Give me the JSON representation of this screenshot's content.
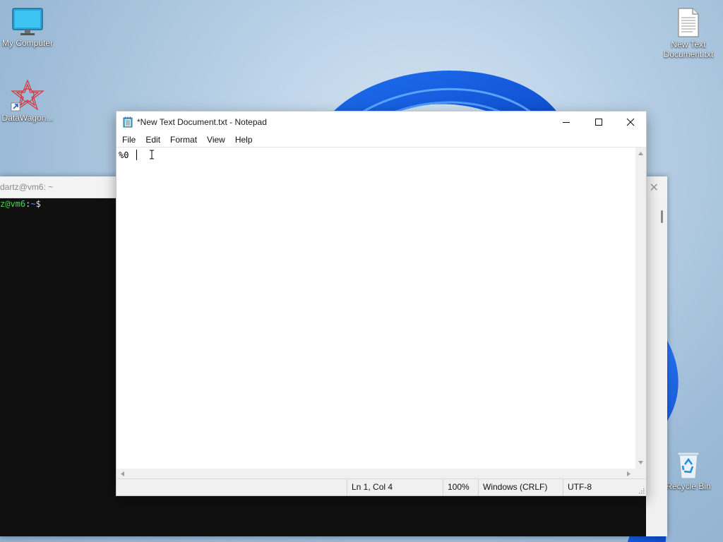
{
  "desktop": {
    "icons": {
      "my_computer": "My Computer",
      "datawagon": "DataWagon...",
      "new_text_doc": "New Text Document.txt",
      "recycle_bin": "Recycle Bin"
    }
  },
  "terminal": {
    "title": "dartz@vm6: ~",
    "prompt_user": "z@vm6",
    "prompt_sep": ":",
    "prompt_path": "~",
    "prompt_symbol": "$",
    "colors": {
      "user": "#4fd14f",
      "path": "#5b8cff",
      "bg": "#101010"
    }
  },
  "notepad": {
    "title": "*New Text Document.txt - Notepad",
    "menu": [
      "File",
      "Edit",
      "Format",
      "View",
      "Help"
    ],
    "content": "%0",
    "status": {
      "position": "Ln 1, Col 4",
      "zoom": "100%",
      "line_ending": "Windows (CRLF)",
      "encoding": "UTF-8"
    }
  }
}
